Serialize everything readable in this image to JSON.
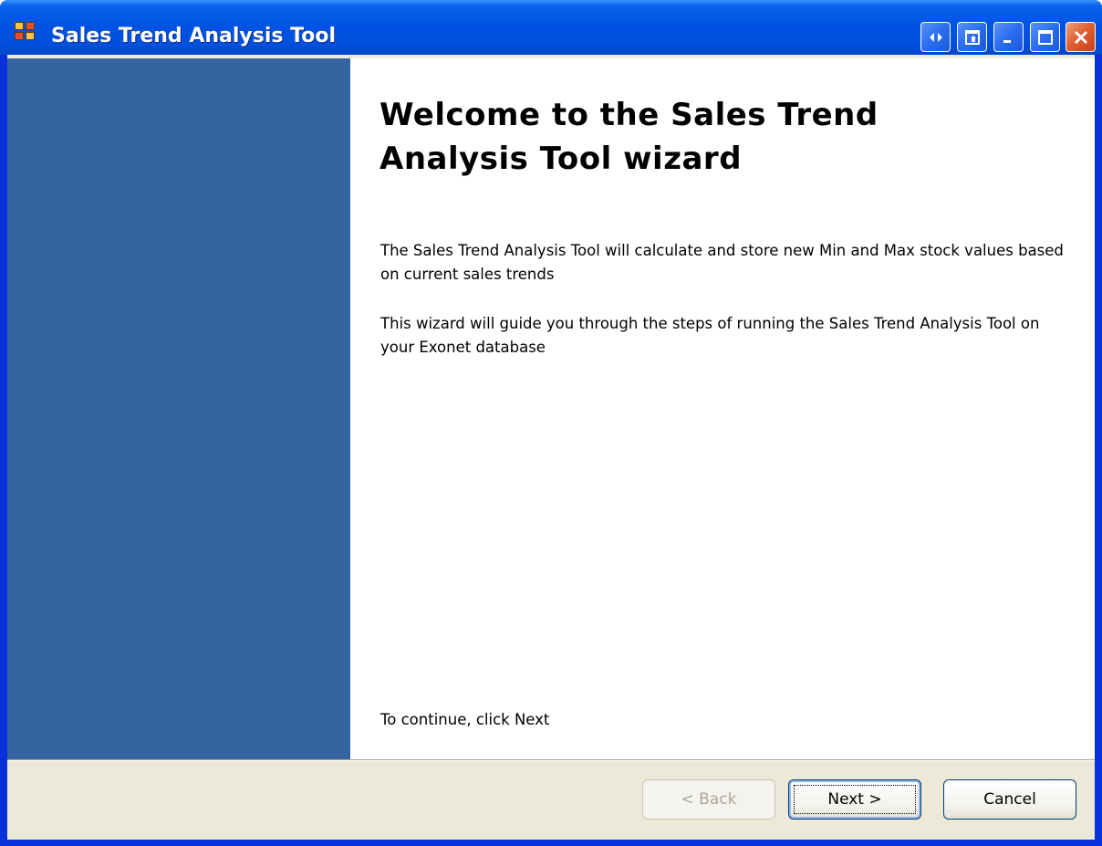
{
  "window": {
    "title": "Sales Trend Analysis Tool",
    "icons": [
      "app-icon",
      "restore-arrows-icon",
      "tile-icon",
      "minimize-icon",
      "maximize-icon",
      "close-icon"
    ]
  },
  "wizard": {
    "heading": "Welcome to the Sales Trend Analysis Tool wizard",
    "paragraph1": "The Sales Trend Analysis Tool will calculate and store new Min and Max stock values based on current sales trends",
    "paragraph2": "This wizard will guide you through the steps of running the Sales Trend Analysis Tool on your Exonet database",
    "continue_text": "To continue, click Next",
    "side_panel_color": "#3465a0"
  },
  "buttons": {
    "back": "< Back",
    "next": "Next >",
    "cancel": "Cancel",
    "back_enabled": false
  }
}
